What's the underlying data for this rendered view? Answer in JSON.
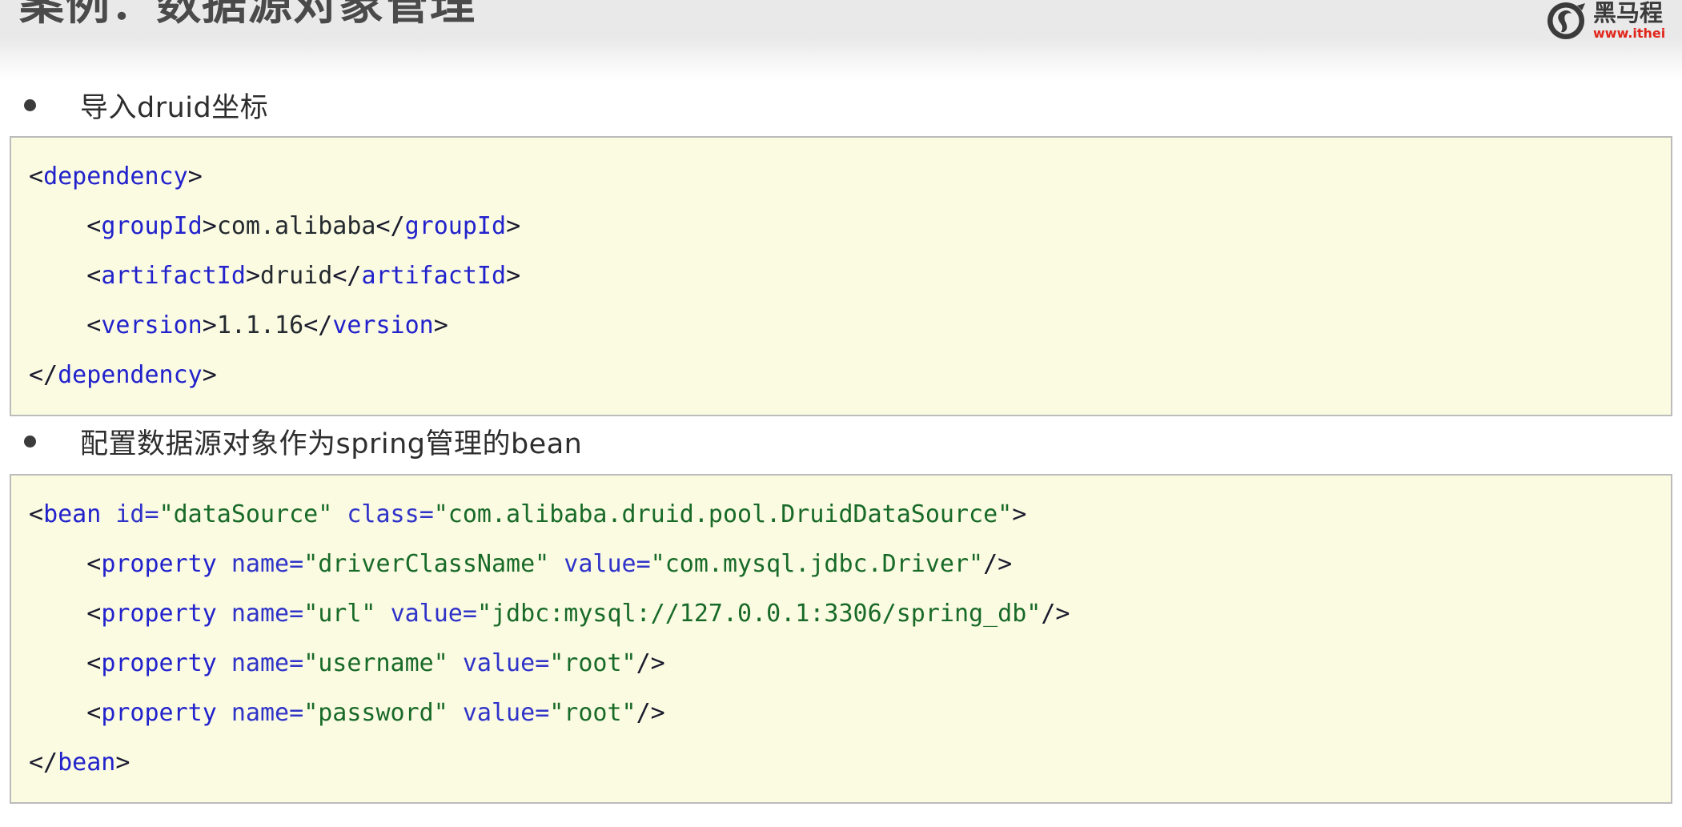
{
  "header": {
    "title": "案例：数据源对象管理",
    "logo": {
      "icon_name": "itheima-horse-logo",
      "brand_cn": "黑马程",
      "brand_url": "www.ithei"
    },
    "band_color": "#e9e9e9",
    "title_color": "#4a4a4a",
    "url_color": "#e1261c"
  },
  "content": {
    "sections": [
      {
        "bullet": "导入druid坐标",
        "code_name": "druid-dependency-code",
        "code_lines": [
          [
            {
              "t": "<",
              "c": "punct"
            },
            {
              "t": "dependency",
              "c": "tag"
            },
            {
              "t": ">",
              "c": "punct"
            }
          ],
          [
            {
              "t": "    <",
              "c": "punct"
            },
            {
              "t": "groupId",
              "c": "tag"
            },
            {
              "t": ">",
              "c": "punct"
            },
            {
              "t": "com.alibaba",
              "c": "txt"
            },
            {
              "t": "</",
              "c": "punct"
            },
            {
              "t": "groupId",
              "c": "tag"
            },
            {
              "t": ">",
              "c": "punct"
            }
          ],
          [
            {
              "t": "    <",
              "c": "punct"
            },
            {
              "t": "artifactId",
              "c": "tag"
            },
            {
              "t": ">",
              "c": "punct"
            },
            {
              "t": "druid",
              "c": "txt"
            },
            {
              "t": "</",
              "c": "punct"
            },
            {
              "t": "artifactId",
              "c": "tag"
            },
            {
              "t": ">",
              "c": "punct"
            }
          ],
          [
            {
              "t": "    <",
              "c": "punct"
            },
            {
              "t": "version",
              "c": "tag"
            },
            {
              "t": ">",
              "c": "punct"
            },
            {
              "t": "1.1.16",
              "c": "txt"
            },
            {
              "t": "</",
              "c": "punct"
            },
            {
              "t": "version",
              "c": "tag"
            },
            {
              "t": ">",
              "c": "punct"
            }
          ],
          [
            {
              "t": "</",
              "c": "punct"
            },
            {
              "t": "dependency",
              "c": "tag"
            },
            {
              "t": ">",
              "c": "punct"
            }
          ]
        ]
      },
      {
        "bullet": "配置数据源对象作为spring管理的bean",
        "code_name": "datasource-bean-code",
        "code_lines": [
          [
            {
              "t": "<",
              "c": "punct"
            },
            {
              "t": "bean",
              "c": "tag"
            },
            {
              "t": " ",
              "c": "txt"
            },
            {
              "t": "id",
              "c": "attr"
            },
            {
              "t": "=",
              "c": "eq"
            },
            {
              "t": "\"dataSource\"",
              "c": "str"
            },
            {
              "t": " ",
              "c": "txt"
            },
            {
              "t": "class",
              "c": "attr"
            },
            {
              "t": "=",
              "c": "eq"
            },
            {
              "t": "\"com.alibaba.druid.pool.DruidDataSource\"",
              "c": "str"
            },
            {
              "t": ">",
              "c": "punct"
            }
          ],
          [
            {
              "t": "    <",
              "c": "punct"
            },
            {
              "t": "property",
              "c": "tag"
            },
            {
              "t": " ",
              "c": "txt"
            },
            {
              "t": "name",
              "c": "attr"
            },
            {
              "t": "=",
              "c": "eq"
            },
            {
              "t": "\"driverClassName\"",
              "c": "str"
            },
            {
              "t": " ",
              "c": "txt"
            },
            {
              "t": "value",
              "c": "attr"
            },
            {
              "t": "=",
              "c": "eq"
            },
            {
              "t": "\"com.mysql.jdbc.Driver\"",
              "c": "str"
            },
            {
              "t": "/>",
              "c": "punct"
            }
          ],
          [
            {
              "t": "    <",
              "c": "punct"
            },
            {
              "t": "property",
              "c": "tag"
            },
            {
              "t": " ",
              "c": "txt"
            },
            {
              "t": "name",
              "c": "attr"
            },
            {
              "t": "=",
              "c": "eq"
            },
            {
              "t": "\"url\"",
              "c": "str"
            },
            {
              "t": " ",
              "c": "txt"
            },
            {
              "t": "value",
              "c": "attr"
            },
            {
              "t": "=",
              "c": "eq"
            },
            {
              "t": "\"jdbc:mysql://127.0.0.1:3306/spring_db\"",
              "c": "str"
            },
            {
              "t": "/>",
              "c": "punct"
            }
          ],
          [
            {
              "t": "    <",
              "c": "punct"
            },
            {
              "t": "property",
              "c": "tag"
            },
            {
              "t": " ",
              "c": "txt"
            },
            {
              "t": "name",
              "c": "attr"
            },
            {
              "t": "=",
              "c": "eq"
            },
            {
              "t": "\"username\"",
              "c": "str"
            },
            {
              "t": " ",
              "c": "txt"
            },
            {
              "t": "value",
              "c": "attr"
            },
            {
              "t": "=",
              "c": "eq"
            },
            {
              "t": "\"root\"",
              "c": "str"
            },
            {
              "t": "/>",
              "c": "punct"
            }
          ],
          [
            {
              "t": "    <",
              "c": "punct"
            },
            {
              "t": "property",
              "c": "tag"
            },
            {
              "t": " ",
              "c": "txt"
            },
            {
              "t": "name",
              "c": "attr"
            },
            {
              "t": "=",
              "c": "eq"
            },
            {
              "t": "\"password\"",
              "c": "str"
            },
            {
              "t": " ",
              "c": "txt"
            },
            {
              "t": "value",
              "c": "attr"
            },
            {
              "t": "=",
              "c": "eq"
            },
            {
              "t": "\"root\"",
              "c": "str"
            },
            {
              "t": "/>",
              "c": "punct"
            }
          ],
          [
            {
              "t": "</",
              "c": "punct"
            },
            {
              "t": "bean",
              "c": "tag"
            },
            {
              "t": ">",
              "c": "punct"
            }
          ]
        ]
      }
    ]
  },
  "colors": {
    "code_bg": "#fbfbe2",
    "code_border": "#bcbcbc",
    "tag": "#2222cc",
    "string": "#186a28",
    "text": "#23292e"
  }
}
